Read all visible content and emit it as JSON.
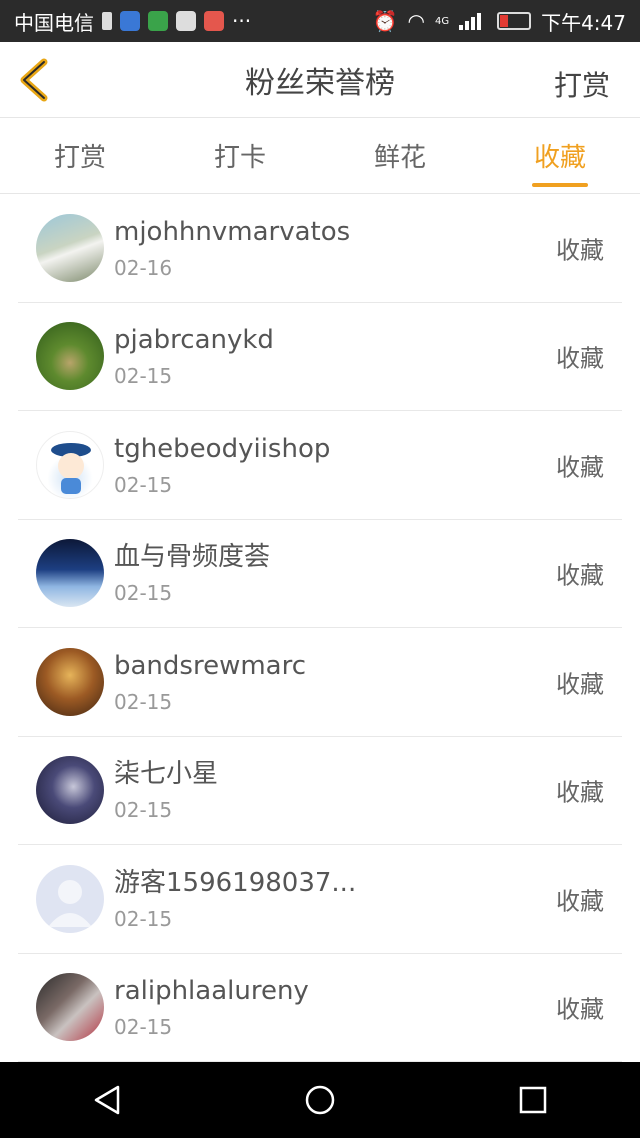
{
  "status_bar": {
    "carrier": "中国电信",
    "network": "4G",
    "time": "下午4:47"
  },
  "header": {
    "title": "粉丝荣誉榜",
    "action": "打赏"
  },
  "tabs": [
    {
      "label": "打赏",
      "active": false
    },
    {
      "label": "打卡",
      "active": false
    },
    {
      "label": "鲜花",
      "active": false
    },
    {
      "label": "收藏",
      "active": true
    }
  ],
  "list": [
    {
      "name": "mjohhnvmarvatos",
      "date": "02-16",
      "action": "收藏"
    },
    {
      "name": "pjabrcanykd",
      "date": "02-15",
      "action": "收藏"
    },
    {
      "name": "tghebeodyiishop",
      "date": "02-15",
      "action": "收藏"
    },
    {
      "name": "血与骨频度荟",
      "date": "02-15",
      "action": "收藏"
    },
    {
      "name": "bandsrewmarc",
      "date": "02-15",
      "action": "收藏"
    },
    {
      "name": "柒七小星",
      "date": "02-15",
      "action": "收藏"
    },
    {
      "name": "游客1596198037...",
      "date": "02-15",
      "action": "收藏"
    },
    {
      "name": "raliphlaalureny",
      "date": "02-15",
      "action": "收藏"
    }
  ],
  "colors": {
    "accent": "#f0a020",
    "status_bar": "#2b2b2b",
    "nav_bar": "#000000"
  }
}
